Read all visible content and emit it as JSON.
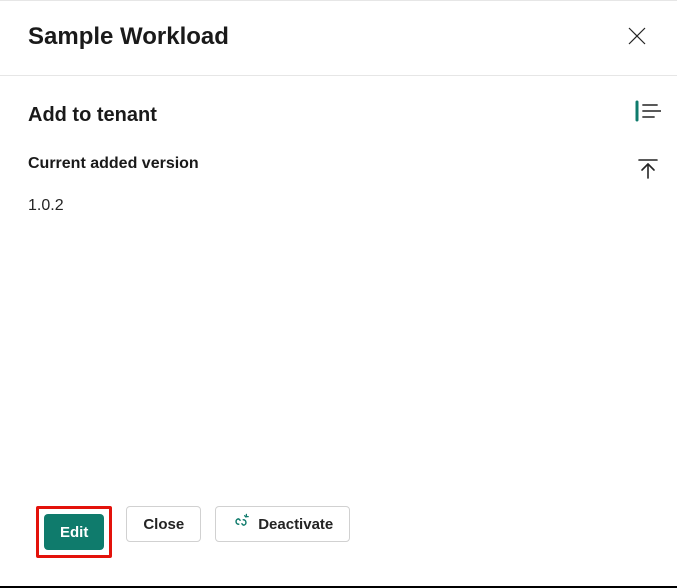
{
  "header": {
    "title": "Sample Workload"
  },
  "main": {
    "section_title": "Add to tenant",
    "version_label": "Current added version",
    "version_value": "1.0.2"
  },
  "footer": {
    "edit_label": "Edit",
    "close_label": "Close",
    "deactivate_label": "Deactivate"
  },
  "colors": {
    "primary": "#0f7b6c",
    "highlight": "#e3120b"
  }
}
